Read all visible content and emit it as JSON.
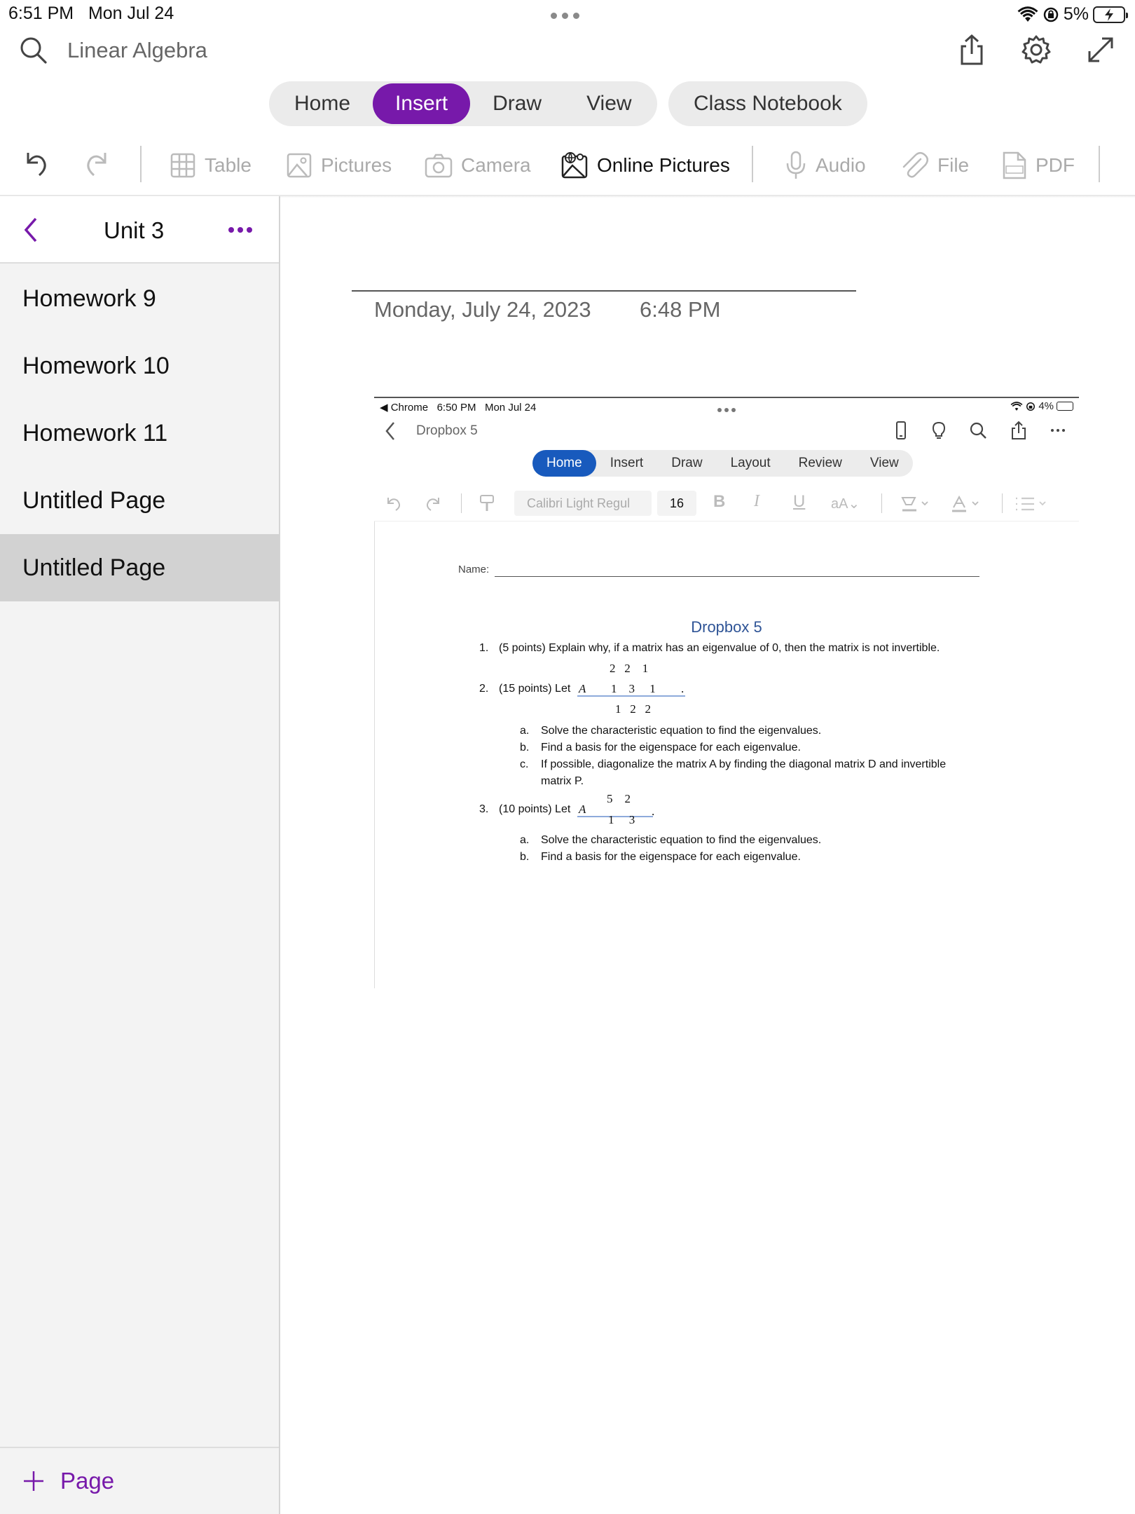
{
  "status_bar": {
    "time": "6:51 PM",
    "date": "Mon Jul 24",
    "battery": "5%"
  },
  "header": {
    "notebook": "Linear Algebra"
  },
  "ribbon": {
    "tabs": [
      "Home",
      "Insert",
      "Draw",
      "View"
    ],
    "active_tab": "Insert",
    "class_notebook": "Class Notebook",
    "accent": "#7719aa"
  },
  "toolbar": {
    "table": "Table",
    "pictures": "Pictures",
    "camera": "Camera",
    "online_pictures": "Online Pictures",
    "audio": "Audio",
    "file": "File",
    "pdf": "PDF"
  },
  "sidebar": {
    "section": "Unit 3",
    "pages": [
      "Homework 9",
      "Homework 10",
      "Homework 11",
      "Untitled Page",
      "Untitled Page"
    ],
    "selected_index": 4,
    "add_page": "Page"
  },
  "page": {
    "date": "Monday, July 24, 2023",
    "time": "6:48 PM"
  },
  "screenshot": {
    "status": {
      "app": "◀ Chrome",
      "time": "6:50 PM",
      "date": "Mon Jul 24",
      "battery": "4%"
    },
    "doc_name": "Dropbox 5",
    "tabs": [
      "Home",
      "Insert",
      "Draw",
      "Layout",
      "Review",
      "View"
    ],
    "active_tab": "Home",
    "font_name": "Calibri Light Regul",
    "font_size": "16",
    "word_accent": "#185abd",
    "doc": {
      "name_label": "Name:",
      "title": "Dropbox 5",
      "q1_num": "1.",
      "q1": "(5 points) Explain why, if a matrix has an eigenvalue of 0, then the matrix is not invertible.",
      "q2_num": "2.",
      "q2": "(15 points) Let",
      "q2_var": "A",
      "q2_matrix": {
        "row1": "2   2    1",
        "row2": "1    3     1",
        "row3": "1   2   2",
        "period": "."
      },
      "q2_parts": [
        {
          "letter": "a.",
          "text": "Solve the characteristic equation to find the eigenvalues."
        },
        {
          "letter": "b.",
          "text": "Find a basis for the eigenspace for each eigenvalue."
        },
        {
          "letter": "c.",
          "text": "If possible, diagonalize the matrix A by finding the diagonal matrix D and invertible"
        }
      ],
      "q2_c_cont": "matrix P.",
      "q3_num": "3.",
      "q3": "(10 points) Let",
      "q3_var": "A",
      "q3_matrix": {
        "row1": "5    2",
        "row2": "1     3",
        "period": "."
      },
      "q3_parts": [
        {
          "letter": "a.",
          "text": "Solve the characteristic equation to find the eigenvalues."
        },
        {
          "letter": "b.",
          "text": "Find a basis for the eigenspace for each eigenvalue."
        }
      ]
    }
  }
}
